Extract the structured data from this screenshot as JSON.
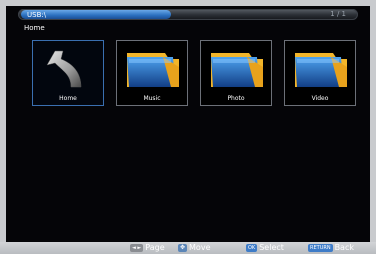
{
  "header": {
    "path": "USB:\\",
    "page_indicator": "1 / 1"
  },
  "breadcrumb": "Home",
  "tiles": [
    {
      "label": "Home",
      "icon": "home-return-icon",
      "selected": true
    },
    {
      "label": "Music",
      "icon": "folder-icon"
    },
    {
      "label": "Photo",
      "icon": "folder-icon"
    },
    {
      "label": "Video",
      "icon": "folder-icon"
    }
  ],
  "footer": {
    "page_label": "Page",
    "move_label": "Move",
    "ok_key": "OK",
    "select_label": "Select",
    "return_key": "RETURN",
    "back_label": "Back"
  },
  "colors": {
    "accent": "#2a6fbe",
    "folder": "#1e5fb0",
    "folder_tab": "#f2b52a"
  }
}
